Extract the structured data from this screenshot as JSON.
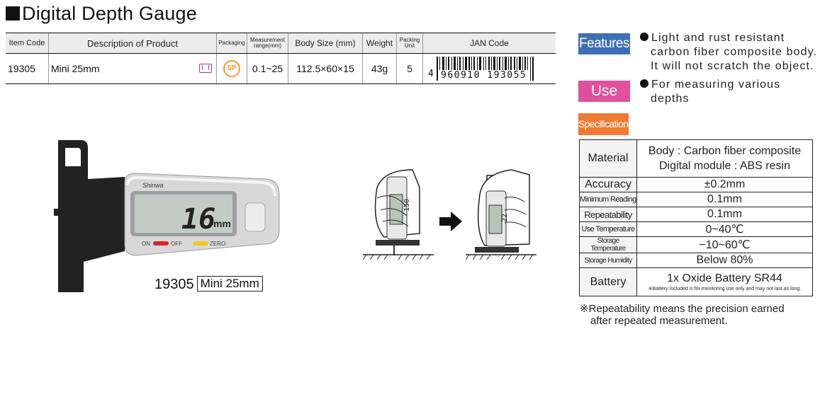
{
  "title": "Digital Depth Gauge",
  "product_table": {
    "headers": {
      "item_code": "Item Code",
      "description": "Description of Product",
      "packaging": "Packaging",
      "measurement_range": "Measurement range(mm)",
      "body_size": "Body Size (mm)",
      "weight": "Weight",
      "packing_unit": "Packing Unit",
      "jan_code": "JAN Code"
    },
    "row": {
      "item_code": "19305",
      "description": "Mini 25mm",
      "packaging_badge": "SP",
      "measurement_range": "0.1~25",
      "body_size": "112.5×60×15",
      "weight": "43g",
      "packing_unit": "5",
      "jan_first_digit": "4",
      "jan_digits": "960910 193055"
    }
  },
  "features": {
    "badge": "Features",
    "lines": [
      "Light and rust resistant",
      "carbon fiber composite body.",
      "It will not scratch the object."
    ]
  },
  "use": {
    "badge": "Use",
    "lines": [
      "For measuring various",
      "depths"
    ]
  },
  "specifications": {
    "badge": "Specifications",
    "rows": [
      {
        "key": "Material",
        "value": "Body : Carbon fiber composite",
        "value2": "Digital module : ABS resin"
      },
      {
        "key": "Accuracy",
        "value": "±0.2mm"
      },
      {
        "key": "Minimum Reading",
        "value": "0.1mm"
      },
      {
        "key": "Repeatability",
        "value": "0.1mm"
      },
      {
        "key": "Use Temperature",
        "value": "0~40℃"
      },
      {
        "key": "Storage Temperature",
        "value": "−10~60℃"
      },
      {
        "key": "Storage Humidity",
        "value": "Below 80%"
      },
      {
        "key": "Battery",
        "value": "1x Oxide Battery SR44",
        "note": "※Battery included is for monitoring use only and may not last as long."
      }
    ],
    "footnote_line1": "※Repeatability means the precision earned",
    "footnote_line2": "after repeated measurement."
  },
  "illustration": {
    "logo": "Shinwa",
    "display_value": "16",
    "display_unit": "mm",
    "button_on": "ON",
    "button_off": "OFF",
    "button_zero": "ZERO",
    "model_code": "19305",
    "model_name": "Mini 25mm",
    "usage_reading_1": "150",
    "usage_reading_2": "22"
  },
  "colors": {
    "features_badge": "#3f6fb5",
    "use_badge": "#e0509c",
    "spec_badge": "#f07a33",
    "packaging_icon": "#b0328c",
    "sp_badge": "#f39a2c"
  }
}
